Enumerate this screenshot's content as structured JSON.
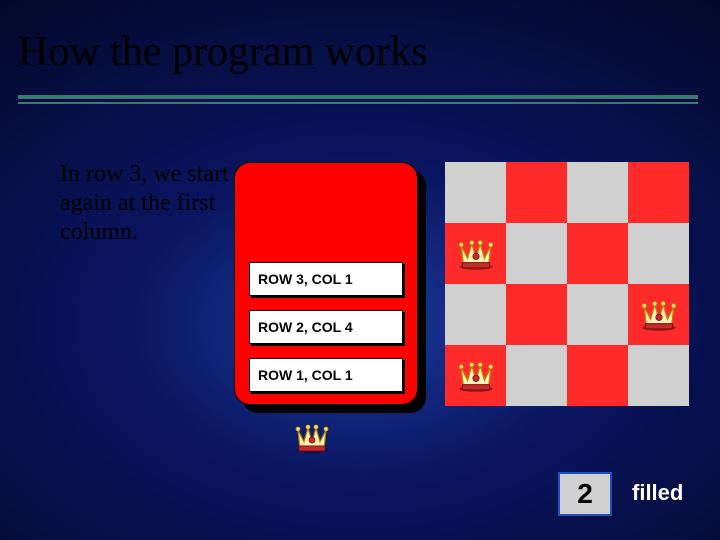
{
  "title": "How the program works",
  "explain": "In row 3, we start again at the first column.",
  "stack": {
    "items": [
      {
        "label": "ROW 3, COL 1"
      },
      {
        "label": "ROW 2, COL 4"
      },
      {
        "label": "ROW 1, COL 1"
      }
    ]
  },
  "board": {
    "size": 4,
    "crowns": [
      {
        "row": 3,
        "col": 1
      },
      {
        "row": 2,
        "col": 4
      },
      {
        "row": 1,
        "col": 1
      }
    ]
  },
  "counter": {
    "value": "2",
    "label": "filled"
  },
  "colors": {
    "red": "#ff0000",
    "light": "#d0d0d0",
    "darkred": "#ff2a2a",
    "teal": "#3a7a70"
  }
}
